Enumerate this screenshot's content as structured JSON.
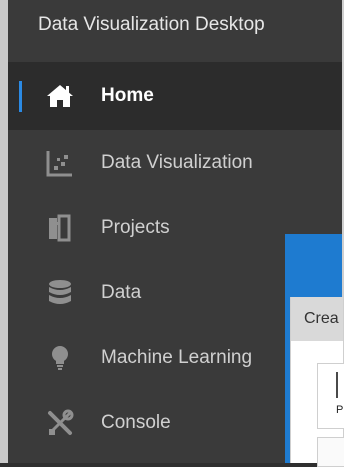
{
  "app": {
    "title": "Data Visualization Desktop"
  },
  "sidebar": {
    "items": [
      {
        "label": "Home",
        "icon": "home-icon",
        "active": true
      },
      {
        "label": "Data Visualization",
        "icon": "scatter-chart-icon",
        "active": false
      },
      {
        "label": "Projects",
        "icon": "projects-icon",
        "active": false
      },
      {
        "label": "Data",
        "icon": "database-icon",
        "active": false
      },
      {
        "label": "Machine Learning",
        "icon": "lightbulb-icon",
        "active": false
      },
      {
        "label": "Console",
        "icon": "wrench-screwdriver-icon",
        "active": false
      }
    ]
  },
  "dialog": {
    "title_partial": "Crea",
    "card_label_partial": "P"
  },
  "colors": {
    "accent": "#2b8ae4",
    "dialog_blue": "#1e7bd0"
  }
}
